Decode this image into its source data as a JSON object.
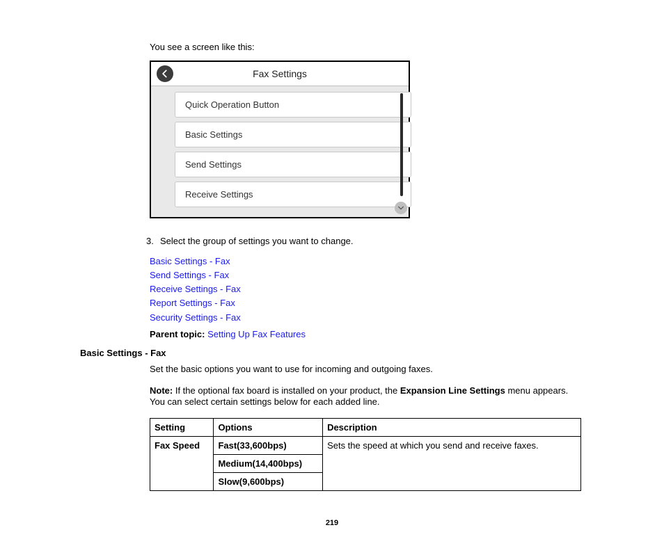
{
  "intro": "You see a screen like this:",
  "device": {
    "title": "Fax Settings",
    "items": [
      "Quick Operation Button",
      "Basic Settings",
      "Send Settings",
      "Receive Settings"
    ]
  },
  "step": {
    "num": "3.",
    "text": "Select the group of settings you want to change."
  },
  "links": [
    "Basic Settings - Fax",
    "Send Settings - Fax",
    "Receive Settings - Fax",
    "Report Settings - Fax",
    "Security Settings - Fax"
  ],
  "parent": {
    "label": "Parent topic:",
    "link": "Setting Up Fax Features"
  },
  "section_heading": "Basic Settings - Fax",
  "section_body": "Set the basic options you want to use for incoming and outgoing faxes.",
  "note": {
    "label": "Note:",
    "before": " If the optional fax board is installed on your product, the ",
    "bold": "Expansion Line Settings",
    "after": " menu appears. You can select certain settings below for each added line."
  },
  "table": {
    "headers": [
      "Setting",
      "Options",
      "Description"
    ],
    "setting": "Fax Speed",
    "options": [
      "Fast(33,600bps)",
      "Medium(14,400bps)",
      "Slow(9,600bps)"
    ],
    "description": "Sets the speed at which you send and receive faxes."
  },
  "page_number": "219"
}
